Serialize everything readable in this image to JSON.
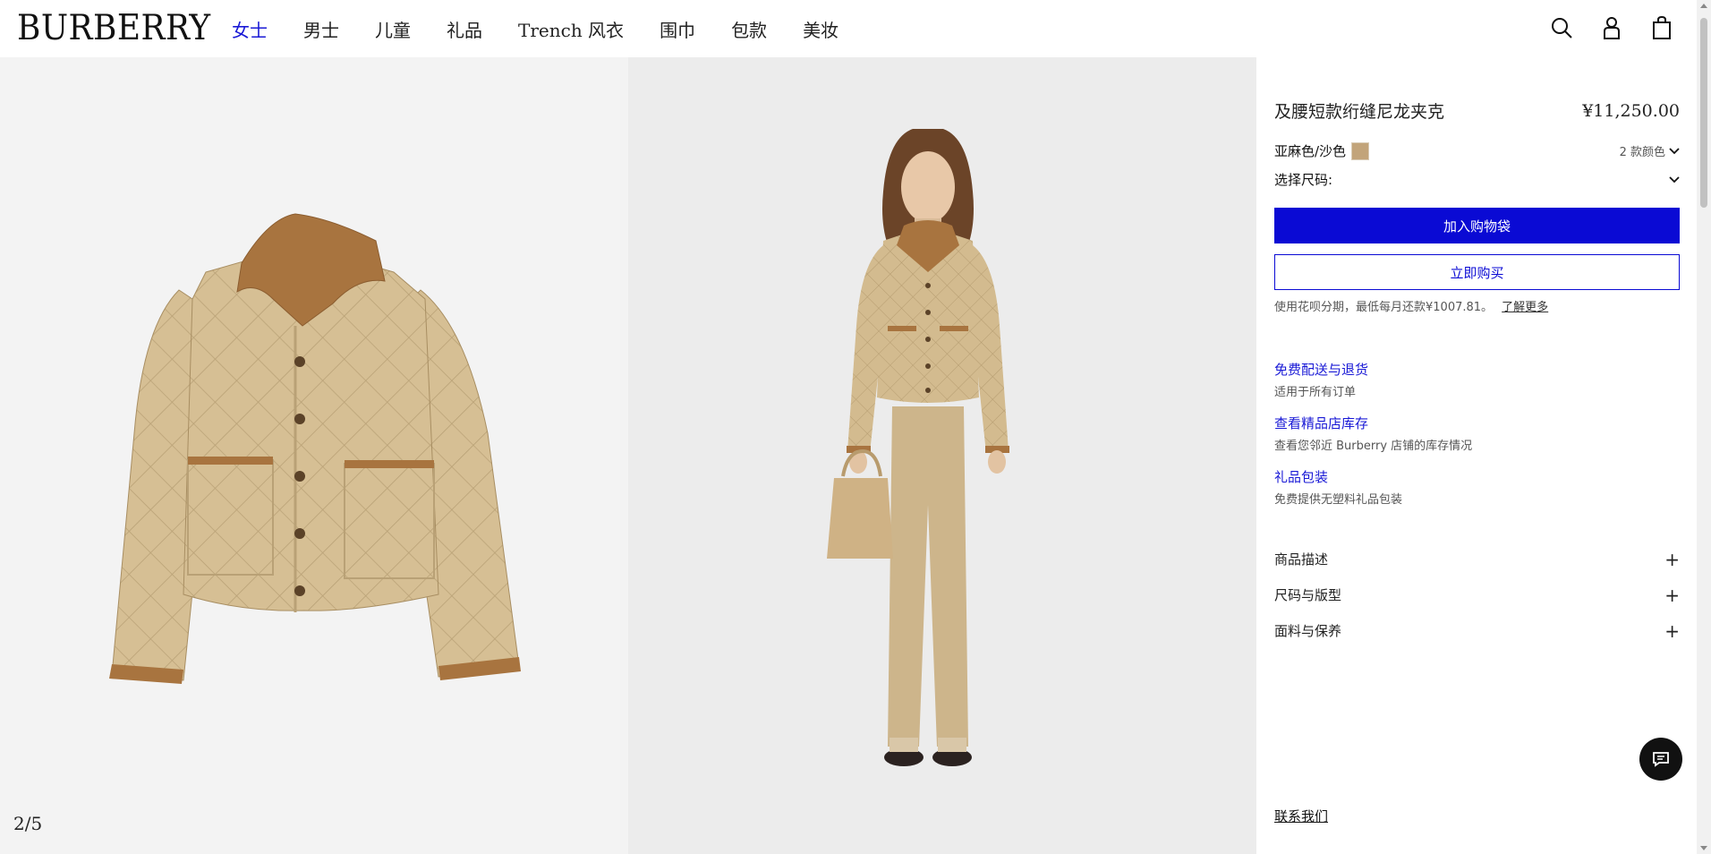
{
  "header": {
    "logo": "BURBERRY",
    "nav": [
      "女士",
      "男士",
      "儿童",
      "礼品",
      "Trench 风衣",
      "围巾",
      "包款",
      "美妆"
    ],
    "active_nav": "女士",
    "icons": [
      "search-icon",
      "account-icon",
      "shopping-bag-icon"
    ]
  },
  "gallery": {
    "counter": "2/5",
    "background_left": "#f3f3f3",
    "background_right": "#ececec"
  },
  "product": {
    "name": "及腰短款绗缝尼龙夹克",
    "price": "¥11,250.00",
    "color_name": "亚麻色/沙色",
    "color_swatch": "#c2a47a",
    "color_count": "2 款颜色",
    "size_label": "选择尺码:",
    "add_to_bag": "加入购物袋",
    "buy_now": "立即购买",
    "installment_text": "使用花呗分期，最低每月还款¥1007.81。",
    "learn_more": "了解更多"
  },
  "services": [
    {
      "title": "免费配送与退货",
      "subtitle": "适用于所有订单"
    },
    {
      "title": "查看精品店库存",
      "subtitle": "查看您邻近 Burberry 店铺的库存情况"
    },
    {
      "title": "礼品包装",
      "subtitle": "免费提供无塑料礼品包装"
    }
  ],
  "accordions": [
    "商品描述",
    "尺码与版型",
    "面料与保养"
  ],
  "contact": "联系我们",
  "colors": {
    "accent": "#0a0ad4",
    "link": "#1a1ad6"
  }
}
